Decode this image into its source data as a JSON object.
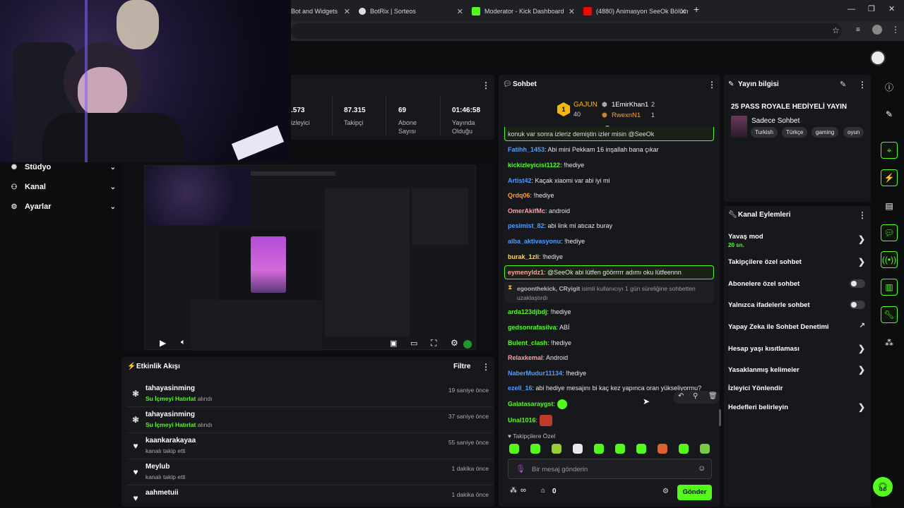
{
  "browser": {
    "tabs": [
      {
        "label": "Bot and Widgets",
        "color": "#888888"
      },
      {
        "label": "BotRix | Sorteos",
        "color": "#dddddd"
      },
      {
        "label": "Moderator - Kick Dashboard",
        "color": "#53fc18"
      },
      {
        "label": "(4880) Animasyon SeeOk Bölüm",
        "color": "#ff0000"
      }
    ],
    "new_tab": "+"
  },
  "stream_stats": [
    {
      "value": ".573",
      "label": "izleyici"
    },
    {
      "value": "87.315",
      "label": "Takipçi"
    },
    {
      "value": "69",
      "label": "Abone Sayısı"
    },
    {
      "value": "01:46:58",
      "label": "Yayında Olduğu"
    }
  ],
  "sidebar": {
    "items": [
      {
        "label": "Stüdyo",
        "icon": "studio-icon"
      },
      {
        "label": "Kanal",
        "icon": "channel-icon"
      },
      {
        "label": "Ayarlar",
        "icon": "settings-icon"
      }
    ]
  },
  "activity": {
    "title": "Etkinlik Akışı",
    "filter": "Filtre",
    "items": [
      {
        "user": "tahayasinming",
        "highlight": "Su İçmeyi Hatırlat",
        "action": " alındı",
        "time": "19 saniye önce",
        "icon": "reward-icon"
      },
      {
        "user": "tahayasinming",
        "highlight": "Su İçmeyi Hatırlat",
        "action": " alındı",
        "time": "37 saniye önce",
        "icon": "reward-icon"
      },
      {
        "user": "kaankarakayaa",
        "highlight": "",
        "action": "kanalı takip etti",
        "time": "55 saniye önce",
        "icon": "heart-icon"
      },
      {
        "user": "Meylub",
        "highlight": "",
        "action": "kanalı takip etti",
        "time": "1 dakika önce",
        "icon": "heart-icon"
      },
      {
        "user": "aahmetuii",
        "highlight": "",
        "action": "",
        "time": "1 dakika önce",
        "icon": "heart-icon"
      }
    ]
  },
  "chat": {
    "title": "Sohbet",
    "leaderboard": {
      "first": {
        "name": "GAJUN",
        "count": "40",
        "rank": "1"
      },
      "second": {
        "name": "1EmirKhan1",
        "count": "2"
      },
      "third": {
        "name": "RwexnN1",
        "count": "1"
      }
    },
    "pinned_partial": "konuk var sonra izleriz demiştin izler misin @SeeOk",
    "messages": [
      {
        "user": "Fatihh_1453",
        "color": "#4f9dff",
        "text": ": Abi mini Pekkam 16 inşallah bana çıkar"
      },
      {
        "user": "kickizleyicisi1122",
        "color": "#53fc18",
        "text": ": !hediye"
      },
      {
        "user": "Artist42",
        "color": "#4f9dff",
        "text": ": Kaçak xiaomi var abi iyi mi"
      },
      {
        "user": "Qrdq06",
        "color": "#ff9f2e",
        "text": ": !hediye"
      },
      {
        "user": "OmerAkifMc",
        "color": "#ff9fa6",
        "text": ": android"
      },
      {
        "user": "pesimist_82",
        "color": "#4f9dff",
        "text": ": abi link mi atıcaz buray"
      },
      {
        "user": "alba_aktivasyonu",
        "color": "#4f9dff",
        "text": ": !hediye"
      },
      {
        "user": "burak_1zli",
        "color": "#ffd54f",
        "text": ": !hediye"
      }
    ],
    "highlight_msg": {
      "user": "eymenyldz1",
      "color": "#ff9fa6",
      "text": ": @SeeOk abi lütfen göörrrrr adımı oku lütfeennn"
    },
    "mod_action": {
      "actors": "egoonthekick, CRyigit",
      "text": " isimli kullanıcıyı 1 gün süreliğine sohbetten uzaklaştırdı"
    },
    "messages2": [
      {
        "user": "arda123djbdj",
        "color": "#53fc18",
        "text": ": !hediye"
      },
      {
        "user": "gedsonrafasilva",
        "color": "#53fc18",
        "text": ": ABİ"
      },
      {
        "user": "Bulent_clash",
        "color": "#53fc18",
        "text": ": !hediye"
      },
      {
        "user": "Relaxkemal",
        "color": "#ff9fa6",
        "text": ": Android"
      },
      {
        "user": "NaberMudur11134",
        "color": "#4f9dff",
        "text": ": !hediye"
      },
      {
        "user": "ezell_16",
        "color": "#4f9dff",
        "text": ": abi hediye mesajını bi kaç kez yapınca oran yükseliyormu?"
      },
      {
        "user": "Galatasaraygst",
        "color": "#53fc18",
        "text": ": "
      },
      {
        "user": "Unal1016",
        "color": "#53fc18",
        "text": ": "
      }
    ],
    "followers_only": "Takipçilere Özel",
    "input_placeholder": "Bir mesaj gönderin",
    "points": "0",
    "send": "Gönder"
  },
  "stream_info": {
    "title": "Yayın bilgisi",
    "stream_title": "25 PASS ROYALE HEDİYELİ YAYIN",
    "category": "Sadece Sohbet",
    "tags": [
      "Turkish",
      "Türkçe",
      "gaming",
      "oyun"
    ]
  },
  "channel_actions": {
    "title": "Kanal Eylemleri",
    "slow_mode": "Yavaş mod",
    "slow_mode_value": "20 sn.",
    "items": [
      {
        "label": "Takipçilere özel sohbet",
        "control": "chevron"
      },
      {
        "label": "Abonelere özel sohbet",
        "control": "toggle"
      },
      {
        "label": "Yalnızca ifadelerle sohbet",
        "control": "toggle"
      },
      {
        "label": "Yapay Zeka ile Sohbet Denetimi",
        "control": "link"
      },
      {
        "label": "Hesap yaşı kısıtlaması",
        "control": "chevron"
      },
      {
        "label": "Yasaklanmış kelimeler",
        "control": "chevron"
      },
      {
        "label": "İzleyici Yönlendir",
        "control": "none"
      },
      {
        "label": "Hedefleri belirleyin",
        "control": "chevron"
      }
    ]
  },
  "colors": {
    "accent": "#53fc18",
    "gold": "#f5b800"
  }
}
